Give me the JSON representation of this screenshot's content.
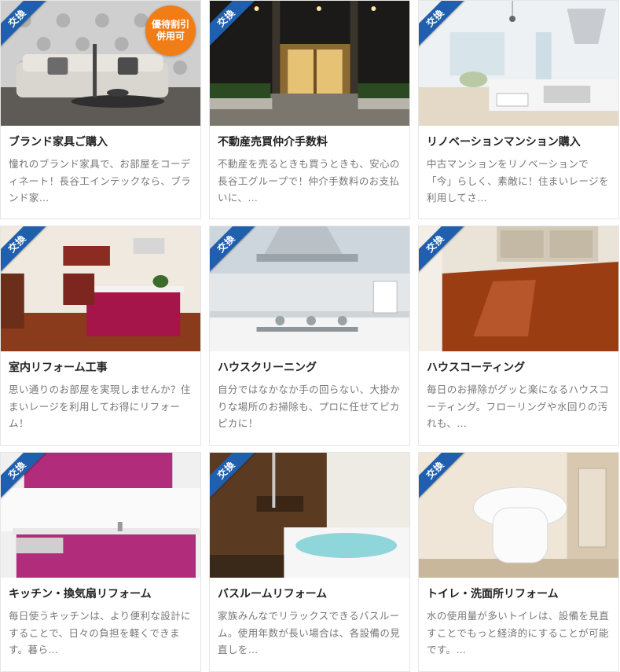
{
  "badge_common": "交換",
  "cards": [
    {
      "title": "ブランド家具ご購入",
      "desc": "憧れのブランド家具で、お部屋をコーディネート！長谷工インテックなら、ブランド家…",
      "badge_line1": "優待割引",
      "badge_line2": "併用可"
    },
    {
      "title": "不動産売買仲介手数料",
      "desc": "不動産を売るときも買うときも、安心の長谷工グループで！仲介手数料のお支払いに、…"
    },
    {
      "title": "リノベーションマンション購入",
      "desc": "中古マンションをリノベーションで「今」らしく、素敵に！住まいレージを利用してさ…"
    },
    {
      "title": "室内リフォーム工事",
      "desc": "思い通りのお部屋を実現しませんか？住まいレージを利用してお得にリフォーム！"
    },
    {
      "title": "ハウスクリーニング",
      "desc": "自分ではなかなか手の回らない、大掛かりな場所のお掃除も、プロに任せてピカピカに！"
    },
    {
      "title": "ハウスコーティング",
      "desc": "毎日のお掃除がグッと楽になるハウスコーティング。フローリングや水回りの汚れも、…"
    },
    {
      "title": "キッチン・換気扇リフォーム",
      "desc": "毎日使うキッチンは、より便利な設計にすることで、日々の負担を軽くできます。暮ら…"
    },
    {
      "title": "バスルームリフォーム",
      "desc": "家族みんなでリラックスできるバスルーム。使用年数が長い場合は、各設備の見直しを…"
    },
    {
      "title": "トイレ・洗面所リフォーム",
      "desc": "水の使用量が多いトイレは、設備を見直すことでもっと経済的にすることが可能です。…"
    }
  ]
}
